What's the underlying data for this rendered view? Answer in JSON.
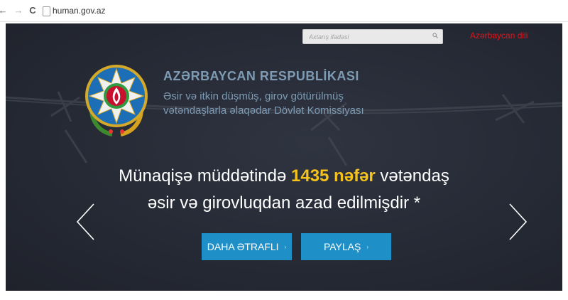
{
  "browser": {
    "url": "human.gov.az",
    "back_glyph": "←",
    "forward_glyph": "→",
    "reload_glyph": "C"
  },
  "header": {
    "search_placeholder": "Axtarış ifadəsi",
    "language_link": "Azərbaycan dili"
  },
  "organization": {
    "title": "AZƏRBAYCAN RESPUBLİKASI",
    "subtitle_line1": "Əsir və itkin düşmüş, girov götürülmüş",
    "subtitle_line2": "vətəndaşlarla əlaqədar Dövlət Komissiyası"
  },
  "headline": {
    "part1": "Münaqişə müddətində ",
    "highlight": "1435 nəfər",
    "part2": " vətəndaş",
    "line2": "əsir və girovluqdan azad edilmişdir *"
  },
  "buttons": {
    "more_label": "DAHA ƏTRAFLI",
    "share_label": "PAYLAŞ",
    "arrow_glyph": "›"
  },
  "colors": {
    "hero_bg": "#262a35",
    "accent_blue": "#1f8fc8",
    "highlight_yellow": "#f4c21a",
    "title_blue": "#7d9bb3",
    "lang_red": "#e0151e"
  }
}
